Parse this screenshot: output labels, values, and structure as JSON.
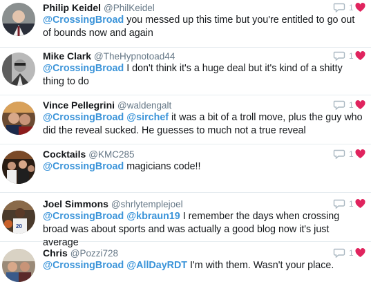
{
  "colors": {
    "mention": "#3b94d9",
    "heart": "#e0245e",
    "handle": "#657786",
    "divider": "#e6ecf0"
  },
  "icons": {
    "reply": "reply-icon",
    "like": "heart-icon"
  },
  "tweets": [
    {
      "name": "Philip Keidel",
      "handle": "@PhilKeidel",
      "likes": "1",
      "mentions": [
        "@CrossingBroad"
      ],
      "body": " you messed up this time but you're entitled to go out of bounds now and again"
    },
    {
      "name": "Mike Clark",
      "handle": "@TheHypnotoad44",
      "likes": "1",
      "mentions": [
        "@CrossingBroad"
      ],
      "body": " I don't think it's a huge deal but it's kind of a shitty thing to do"
    },
    {
      "name": "Vince Pellegrini",
      "handle": "@waldengalt",
      "likes": "1",
      "mentions": [
        "@CrossingBroad",
        "@sirchef"
      ],
      "body": " it was a bit of a troll move, plus the guy who did the reveal sucked. He guesses to much not a true reveal"
    },
    {
      "name": "Cocktails",
      "handle": "@KMC285",
      "likes": "1",
      "mentions": [
        "@CrossingBroad"
      ],
      "body": " magicians code!!"
    },
    {
      "name": "Joel Simmons",
      "handle": "@shrlytemplejoel",
      "likes": "1",
      "mentions": [
        "@CrossingBroad",
        "@kbraun19"
      ],
      "body": " I remember the days when crossing broad was about sports and was actually a good blog now it's just average"
    },
    {
      "name": "Chris",
      "handle": "@Pozzi728",
      "likes": "1",
      "mentions": [
        "@CrossingBroad",
        "@AllDayRDT"
      ],
      "body": " I'm with them. Wasn't your place."
    }
  ]
}
